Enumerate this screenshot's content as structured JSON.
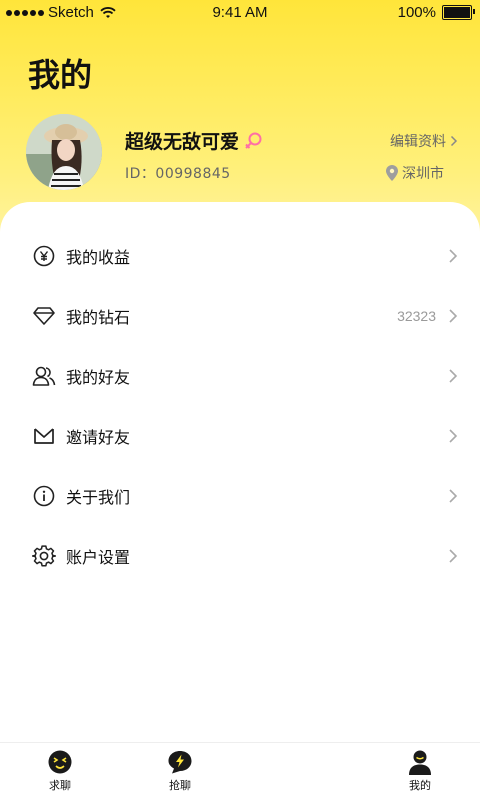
{
  "status_bar": {
    "carrier": "Sketch",
    "time": "9:41 AM",
    "battery": "100%"
  },
  "page_title": "我的",
  "profile": {
    "username": "超级无敌可爱",
    "id_text": "ID：00998845",
    "edit_label": "编辑资料",
    "location": "深圳市",
    "gender_color": "#FF6FA6"
  },
  "menu": {
    "items": [
      {
        "label": "我的收益",
        "value": "",
        "icon": "yen-circle-icon"
      },
      {
        "label": "我的钻石",
        "value": "32323",
        "icon": "diamond-icon"
      },
      {
        "label": "我的好友",
        "value": "",
        "icon": "friends-icon"
      },
      {
        "label": "邀请好友",
        "value": "",
        "icon": "envelope-icon"
      },
      {
        "label": "关于我们",
        "value": "",
        "icon": "info-circle-icon"
      },
      {
        "label": "账户设置",
        "value": "",
        "icon": "gear-icon"
      }
    ]
  },
  "tabs": [
    {
      "label": "求聊",
      "icon": "face-icon",
      "active": false
    },
    {
      "label": "抢聊",
      "icon": "lightning-bubble-icon",
      "active": false
    },
    {
      "label": "我的",
      "icon": "user-icon",
      "active": true
    }
  ],
  "colors": {
    "header_yellow": "#FFE53A",
    "text_primary": "#111111",
    "text_secondary": "#666666"
  }
}
